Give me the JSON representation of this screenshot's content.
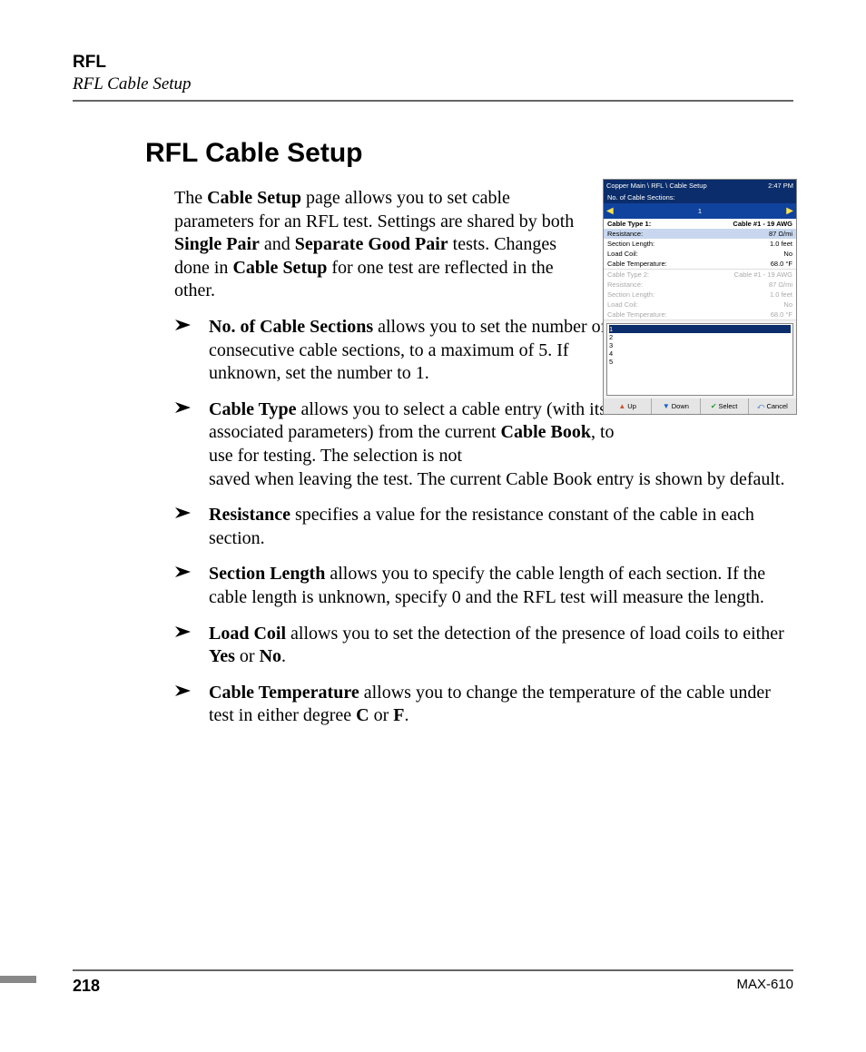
{
  "header": {
    "category": "RFL",
    "subtext": "RFL Cable Setup"
  },
  "title": "RFL Cable Setup",
  "intro_parts": {
    "t1": "The ",
    "b1": "Cable Setup",
    "t2": " page allows you to set cable parameters for an RFL test. Settings are shared by both ",
    "b2": "Single Pair",
    "t3": " and ",
    "b3": "Separate Good Pair",
    "t4": " tests. Changes done in ",
    "b4": "Cable Setup",
    "t5": " for one test are reflected in the other."
  },
  "bullets": {
    "b0": {
      "lead": "No. of Cable Sections",
      "rest": " allows you to set the number of consecutive cable sections, to a maximum of 5. If unknown, set the number to 1."
    },
    "b1": {
      "lead": "Cable Type",
      "first": " allows you to select a cable entry (with its associated parameters) from the current ",
      "bold2": "Cable Book",
      "mid": ", to use for testing. The selection is not",
      "wrap": "saved when leaving the test. The current Cable Book entry is shown by default."
    },
    "b2": {
      "lead": "Resistance",
      "rest": " specifies a value for the resistance constant of the cable in each section."
    },
    "b3": {
      "lead": "Section Length",
      "rest": " allows you to specify the cable length of each section. If the cable length is unknown, specify 0 and the RFL test will measure the length."
    },
    "b4": {
      "lead": "Load Coil",
      "t1": " allows you to set the detection of the presence of load coils to either ",
      "bY": "Yes",
      "t2": " or ",
      "bN": "No",
      "t3": "."
    },
    "b5": {
      "lead": "Cable Temperature",
      "t1": " allows you to change the temperature of the cable under test in either degree ",
      "bC": "C",
      "t2": " or ",
      "bF": "F",
      "t3": "."
    }
  },
  "screenshot": {
    "breadcrumb": "Copper Main \\ RFL \\ Cable Setup",
    "clock": "2:47 PM",
    "field_label": "No. of Cable Sections:",
    "spinner_value": "1",
    "section1": {
      "rows": [
        {
          "k": "Cable Type 1:",
          "v": "Cable #1 - 19 AWG"
        },
        {
          "k": "Resistance:",
          "v": "87 Ω/mi"
        },
        {
          "k": "Section Length:",
          "v": "1.0 feet"
        },
        {
          "k": "Load Coil:",
          "v": "No"
        },
        {
          "k": "Cable Temperature:",
          "v": "68.0 °F"
        }
      ]
    },
    "section2": {
      "rows": [
        {
          "k": "Cable Type 2:",
          "v": "Cable #1 - 19 AWG"
        },
        {
          "k": "Resistance:",
          "v": "87 Ω/mi"
        },
        {
          "k": "Section Length:",
          "v": "1.0 feet"
        },
        {
          "k": "Load Coil:",
          "v": "No"
        },
        {
          "k": "Cable Temperature:",
          "v": "68.0 °F"
        }
      ]
    },
    "list_items": [
      "1",
      "2",
      "3",
      "4",
      "5"
    ],
    "softkeys": {
      "up": "Up",
      "down": "Down",
      "select": "Select",
      "cancel": "Cancel"
    }
  },
  "footer": {
    "page_number": "218",
    "model": "MAX-610"
  }
}
